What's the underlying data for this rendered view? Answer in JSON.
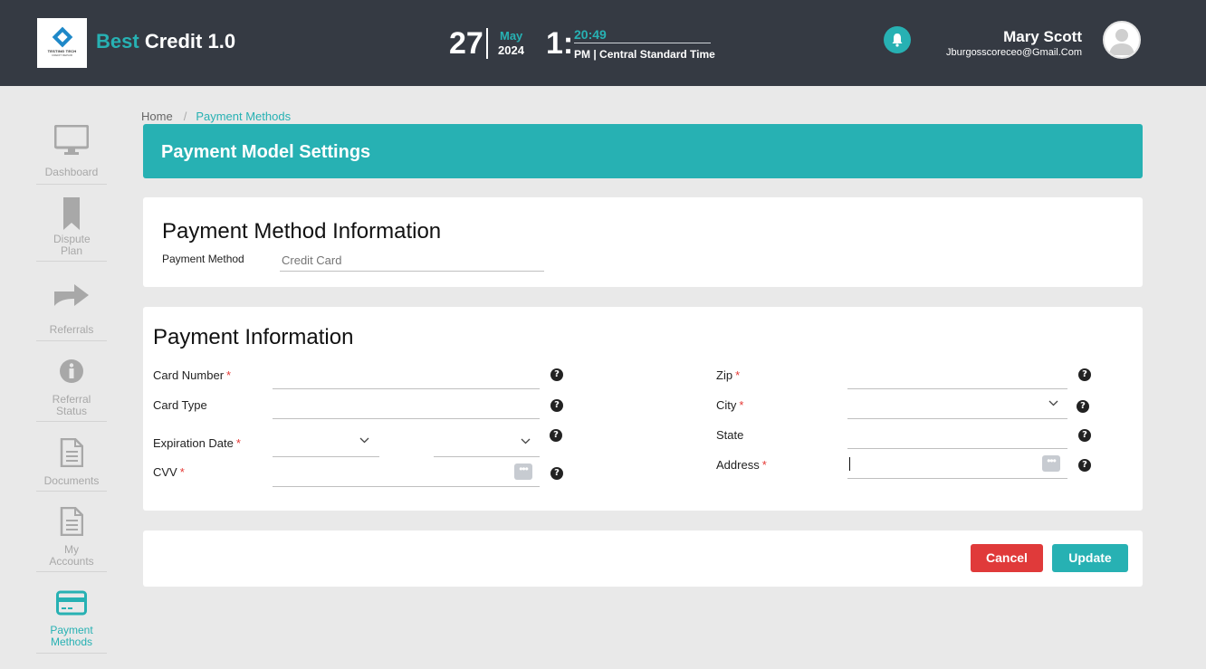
{
  "header": {
    "logo_text": "TESTING TECH",
    "logo_sub": "CREDIT REPAIR",
    "app_name_accent": "Best",
    "app_name_rest": "Credit 1.0",
    "date_day": "27",
    "date_month": "May",
    "date_year": "2024",
    "time_hour": "1:",
    "time_minutes": "20:49",
    "time_tz": "PM | Central Standard Time",
    "user_name": "Mary Scott",
    "user_email": "Jburgosscoreceo@Gmail.Com"
  },
  "sidebar": {
    "items": [
      {
        "label": "Dashboard",
        "icon": "monitor-icon"
      },
      {
        "label": "Dispute Plan",
        "icon": "bookmark-icon"
      },
      {
        "label": "Referrals",
        "icon": "share-arrow-icon"
      },
      {
        "label": "Referral Status",
        "icon": "info-icon"
      },
      {
        "label": "Documents",
        "icon": "document-icon"
      },
      {
        "label": "My Accounts",
        "icon": "document-icon"
      },
      {
        "label": "Payment Methods",
        "icon": "credit-card-icon"
      }
    ],
    "active_color": "#27b1b3"
  },
  "breadcrumb": {
    "home": "Home",
    "separator": "/",
    "current": "Payment Methods"
  },
  "banner": {
    "title": "Payment Model Settings",
    "color": "#27b1b3"
  },
  "method_card": {
    "title": "Payment Method Information",
    "method_label": "Payment Method",
    "method_placeholder": "Credit Card"
  },
  "payment_card": {
    "title": "Payment Information",
    "card_number_label": "Card Number",
    "card_type_label": "Card Type",
    "expiration_label": "Expiration Date",
    "cvv_label": "CVV",
    "zip_label": "Zip",
    "city_label": "City",
    "state_label": "State",
    "address_label": "Address",
    "required_mark": "*",
    "help_glyph": "?",
    "dots_glyph": "•••"
  },
  "actions": {
    "cancel_label": "Cancel",
    "update_label": "Update",
    "cancel_color": "#e03a3a",
    "update_color": "#27b1b3"
  }
}
